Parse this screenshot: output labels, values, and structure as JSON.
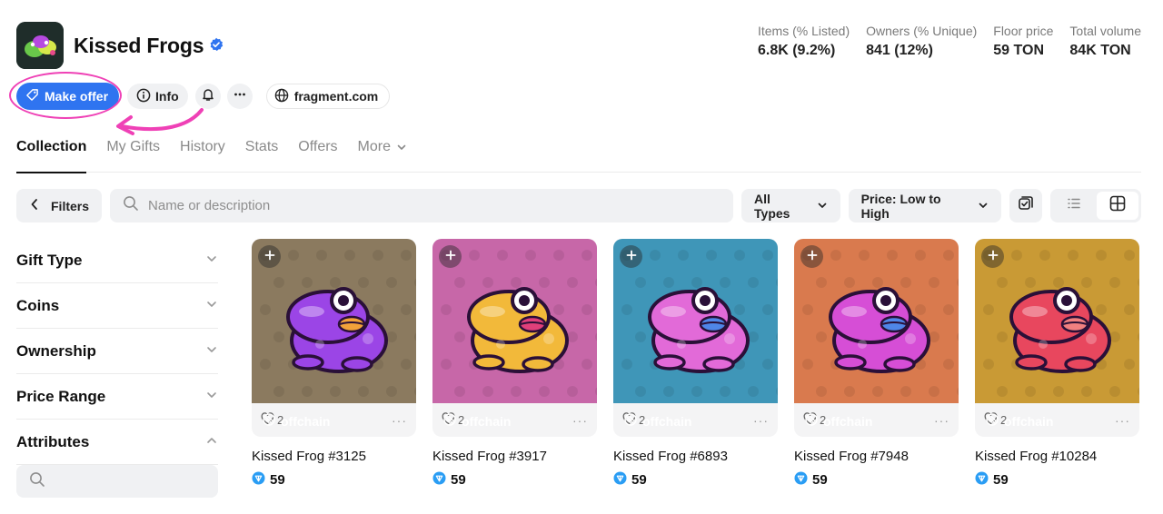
{
  "collection": {
    "title": "Kissed Frogs",
    "verified": true
  },
  "stats": [
    {
      "label": "Items (% Listed)",
      "value": "6.8K (9.2%)"
    },
    {
      "label": "Owners (% Unique)",
      "value": "841 (12%)"
    },
    {
      "label": "Floor price",
      "value": "59 TON"
    },
    {
      "label": "Total volume",
      "value": "84K TON"
    }
  ],
  "actions": {
    "make_offer": "Make offer",
    "info": "Info",
    "site": "fragment.com"
  },
  "tabs": [
    {
      "label": "Collection",
      "active": true
    },
    {
      "label": "My Gifts",
      "active": false
    },
    {
      "label": "History",
      "active": false
    },
    {
      "label": "Stats",
      "active": false
    },
    {
      "label": "Offers",
      "active": false
    },
    {
      "label": "More",
      "active": false
    }
  ],
  "toolbar": {
    "filters": "Filters",
    "search_placeholder": "Name or description",
    "type_select": "All Types",
    "sort_select": "Price: Low to High"
  },
  "sidebar": {
    "items": [
      {
        "label": "Gift Type",
        "expanded": false
      },
      {
        "label": "Coins",
        "expanded": false
      },
      {
        "label": "Ownership",
        "expanded": false
      },
      {
        "label": "Price Range",
        "expanded": false
      },
      {
        "label": "Attributes",
        "expanded": true
      }
    ]
  },
  "cards": [
    {
      "name": "Kissed Frog #3125",
      "price": "59",
      "likes": "2",
      "tag": "offchain",
      "bg": "#8b7a5f",
      "frog": "#9b45e6",
      "lips": "#f2a23a"
    },
    {
      "name": "Kissed Frog #3917",
      "price": "59",
      "likes": "2",
      "tag": "offchain",
      "bg": "#c767a8",
      "frog": "#f2b93a",
      "lips": "#e0407a"
    },
    {
      "name": "Kissed Frog #6893",
      "price": "59",
      "likes": "2",
      "tag": "offchain",
      "bg": "#3f96b8",
      "frog": "#e26ad8",
      "lips": "#4f86e8"
    },
    {
      "name": "Kissed Frog #7948",
      "price": "59",
      "likes": "2",
      "tag": "offchain",
      "bg": "#d97a4e",
      "frog": "#d64ed6",
      "lips": "#4f86e8"
    },
    {
      "name": "Kissed Frog #10284",
      "price": "59",
      "likes": "2",
      "tag": "offchain",
      "bg": "#c99a35",
      "frog": "#e8475e",
      "lips": "#f08080"
    }
  ],
  "colors": {
    "accent": "#2f74f0",
    "highlight": "#ef41b6",
    "ton": "#2a9df4"
  }
}
